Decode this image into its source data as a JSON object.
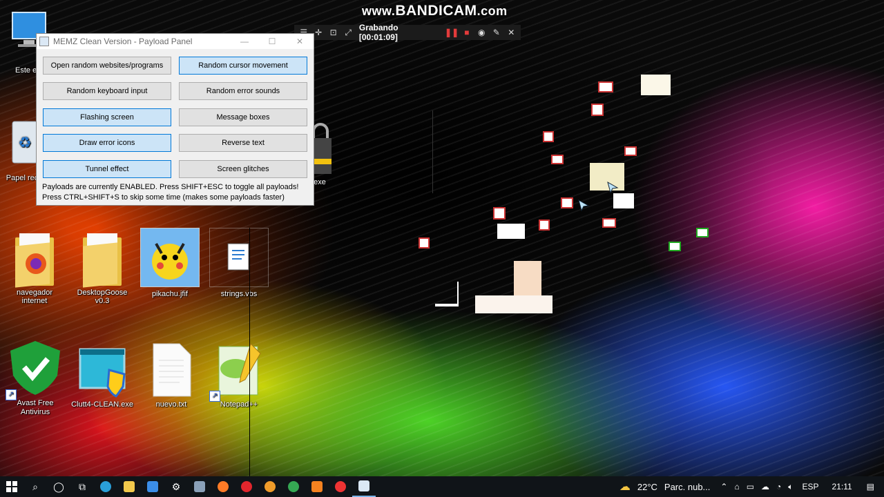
{
  "watermark": {
    "prefix": "www.",
    "brand": "BANDICAM",
    "suffix": ".com"
  },
  "recorder": {
    "status": "Grabando [00:01:09]"
  },
  "desktop_icons": [
    {
      "label": "Este e"
    },
    {
      "label": "Papel recic"
    },
    {
      "label": "r.exe"
    },
    {
      "label": "navegador internet"
    },
    {
      "label": "DesktopGoose v0.3"
    },
    {
      "label": "pikachu.jfif"
    },
    {
      "label": "strings.vbs"
    },
    {
      "label": "Avast Free Antivirus"
    },
    {
      "label": "Clutt4-CLEAN.exe"
    },
    {
      "label": "nuevo.txt"
    },
    {
      "label": "Notepad++"
    }
  ],
  "memz": {
    "title": "MEMZ Clean Version - Payload Panel",
    "buttons": [
      {
        "label": "Open random websites/programs"
      },
      {
        "label": "Random cursor movement"
      },
      {
        "label": "Random keyboard input"
      },
      {
        "label": "Random error sounds"
      },
      {
        "label": "Flashing screen"
      },
      {
        "label": "Message boxes"
      },
      {
        "label": "Draw error icons"
      },
      {
        "label": "Reverse text"
      },
      {
        "label": "Tunnel effect"
      },
      {
        "label": "Screen glitches"
      }
    ],
    "status_line1": "Payloads are currently ENABLED. Press SHIFT+ESC to toggle all payloads!",
    "status_line2": "Press CTRL+SHIFT+S to skip some time (makes some payloads faster)"
  },
  "taskbar": {
    "temperature": "22°C",
    "weather": "Parc. nub...",
    "language": "ESP",
    "time": "21:11"
  },
  "colors": {
    "active_button": "#cce4f7",
    "taskbar": "#101418"
  }
}
